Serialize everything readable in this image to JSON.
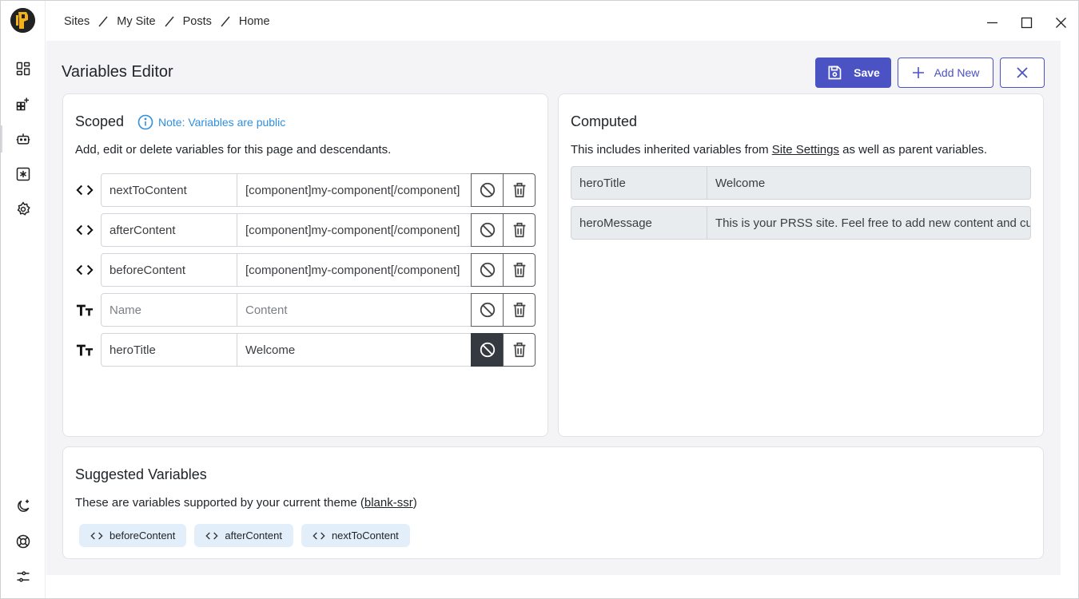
{
  "breadcrumb": [
    {
      "label": "Sites"
    },
    {
      "label": "My Site"
    },
    {
      "label": "Posts"
    },
    {
      "label": "Home"
    }
  ],
  "header": {
    "title": "Variables Editor",
    "save_label": "Save",
    "add_label": "Add New"
  },
  "scoped": {
    "title": "Scoped",
    "note": "Note: Variables are public",
    "description": "Add, edit or delete variables for this page and descendants.",
    "rows": [
      {
        "type": "html",
        "name": "nextToContent",
        "value": "[component]my-component[/component]"
      },
      {
        "type": "html",
        "name": "afterContent",
        "value": "[component]my-component[/component]"
      },
      {
        "type": "html",
        "name": "beforeContent",
        "value": "[component]my-component[/component]"
      },
      {
        "type": "text",
        "name": "",
        "value": "",
        "name_placeholder": "Name",
        "value_placeholder": "Content"
      },
      {
        "type": "text",
        "name": "heroTitle",
        "value": "Welcome",
        "disabled": true
      }
    ]
  },
  "computed": {
    "title": "Computed",
    "description_before": "This includes inherited variables from ",
    "description_link": "Site Settings",
    "description_after": " as well as parent variables.",
    "rows": [
      {
        "name": "heroTitle",
        "value": "Welcome"
      },
      {
        "name": "heroMessage",
        "value": "This is your PRSS site. Feel free to add new content and customize it."
      }
    ]
  },
  "suggested": {
    "title": "Suggested Variables",
    "description_before": "These are variables supported by your current theme (",
    "theme_link": "blank-ssr",
    "description_after": ")",
    "chips": [
      {
        "label": "beforeContent"
      },
      {
        "label": "afterContent"
      },
      {
        "label": "nextToContent"
      }
    ]
  },
  "colors": {
    "accent": "#4a52c4",
    "note_blue": "#2f8fe0",
    "chip_bg": "#e3eefb",
    "active_toggle": "#343a40"
  },
  "icons": {
    "sidebar": [
      "dashboard-icon",
      "apps-add-icon",
      "robot-icon",
      "asterisk-box-icon",
      "gear-icon",
      "moon-plus-icon",
      "lifebuoy-icon",
      "sliders-icon"
    ]
  }
}
